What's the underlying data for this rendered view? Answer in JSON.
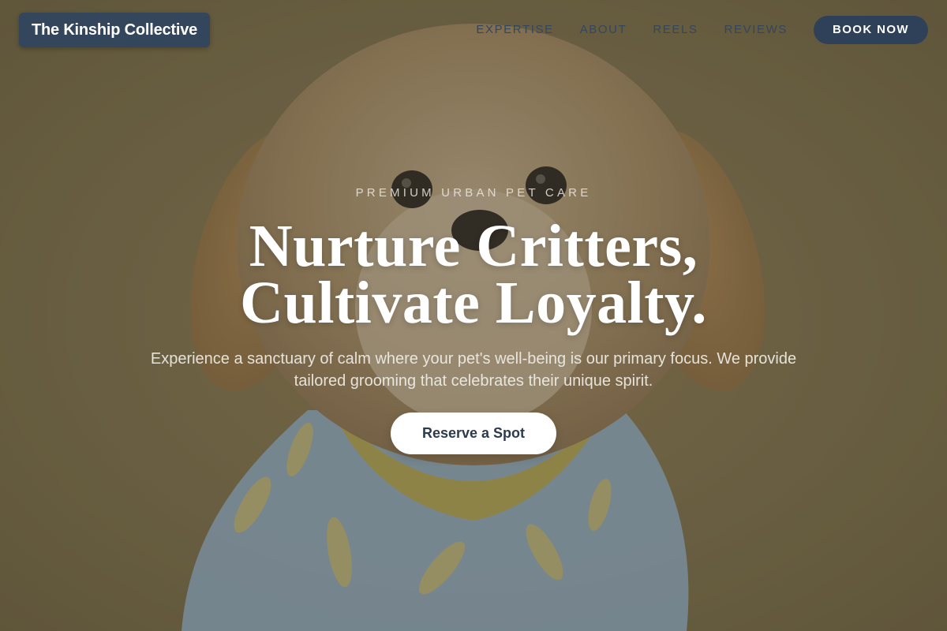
{
  "header": {
    "brand": "The Kinship Collective",
    "nav": [
      {
        "label": "EXPERTISE"
      },
      {
        "label": "ABOUT"
      },
      {
        "label": "REELS"
      },
      {
        "label": "REVIEWS"
      }
    ],
    "book_button": "BOOK NOW"
  },
  "hero": {
    "eyebrow": "PREMIUM URBAN PET CARE",
    "headline_line1": "Nurture Critters,",
    "headline_line2": "Cultivate Loyalty.",
    "subtext": "Experience a sanctuary of calm where your pet's well-being is our primary focus. We provide tailored grooming that celebrates their unique spirit.",
    "cta": "Reserve a Spot",
    "background_image": "dog-in-banana-shirt-photo"
  },
  "colors": {
    "background": "#7d7250",
    "brand_bg": "#34465c",
    "nav_text": "#34465c",
    "button_dark": "#2f4159",
    "cta_bg": "#ffffff",
    "cta_text": "#2c3a4e"
  }
}
